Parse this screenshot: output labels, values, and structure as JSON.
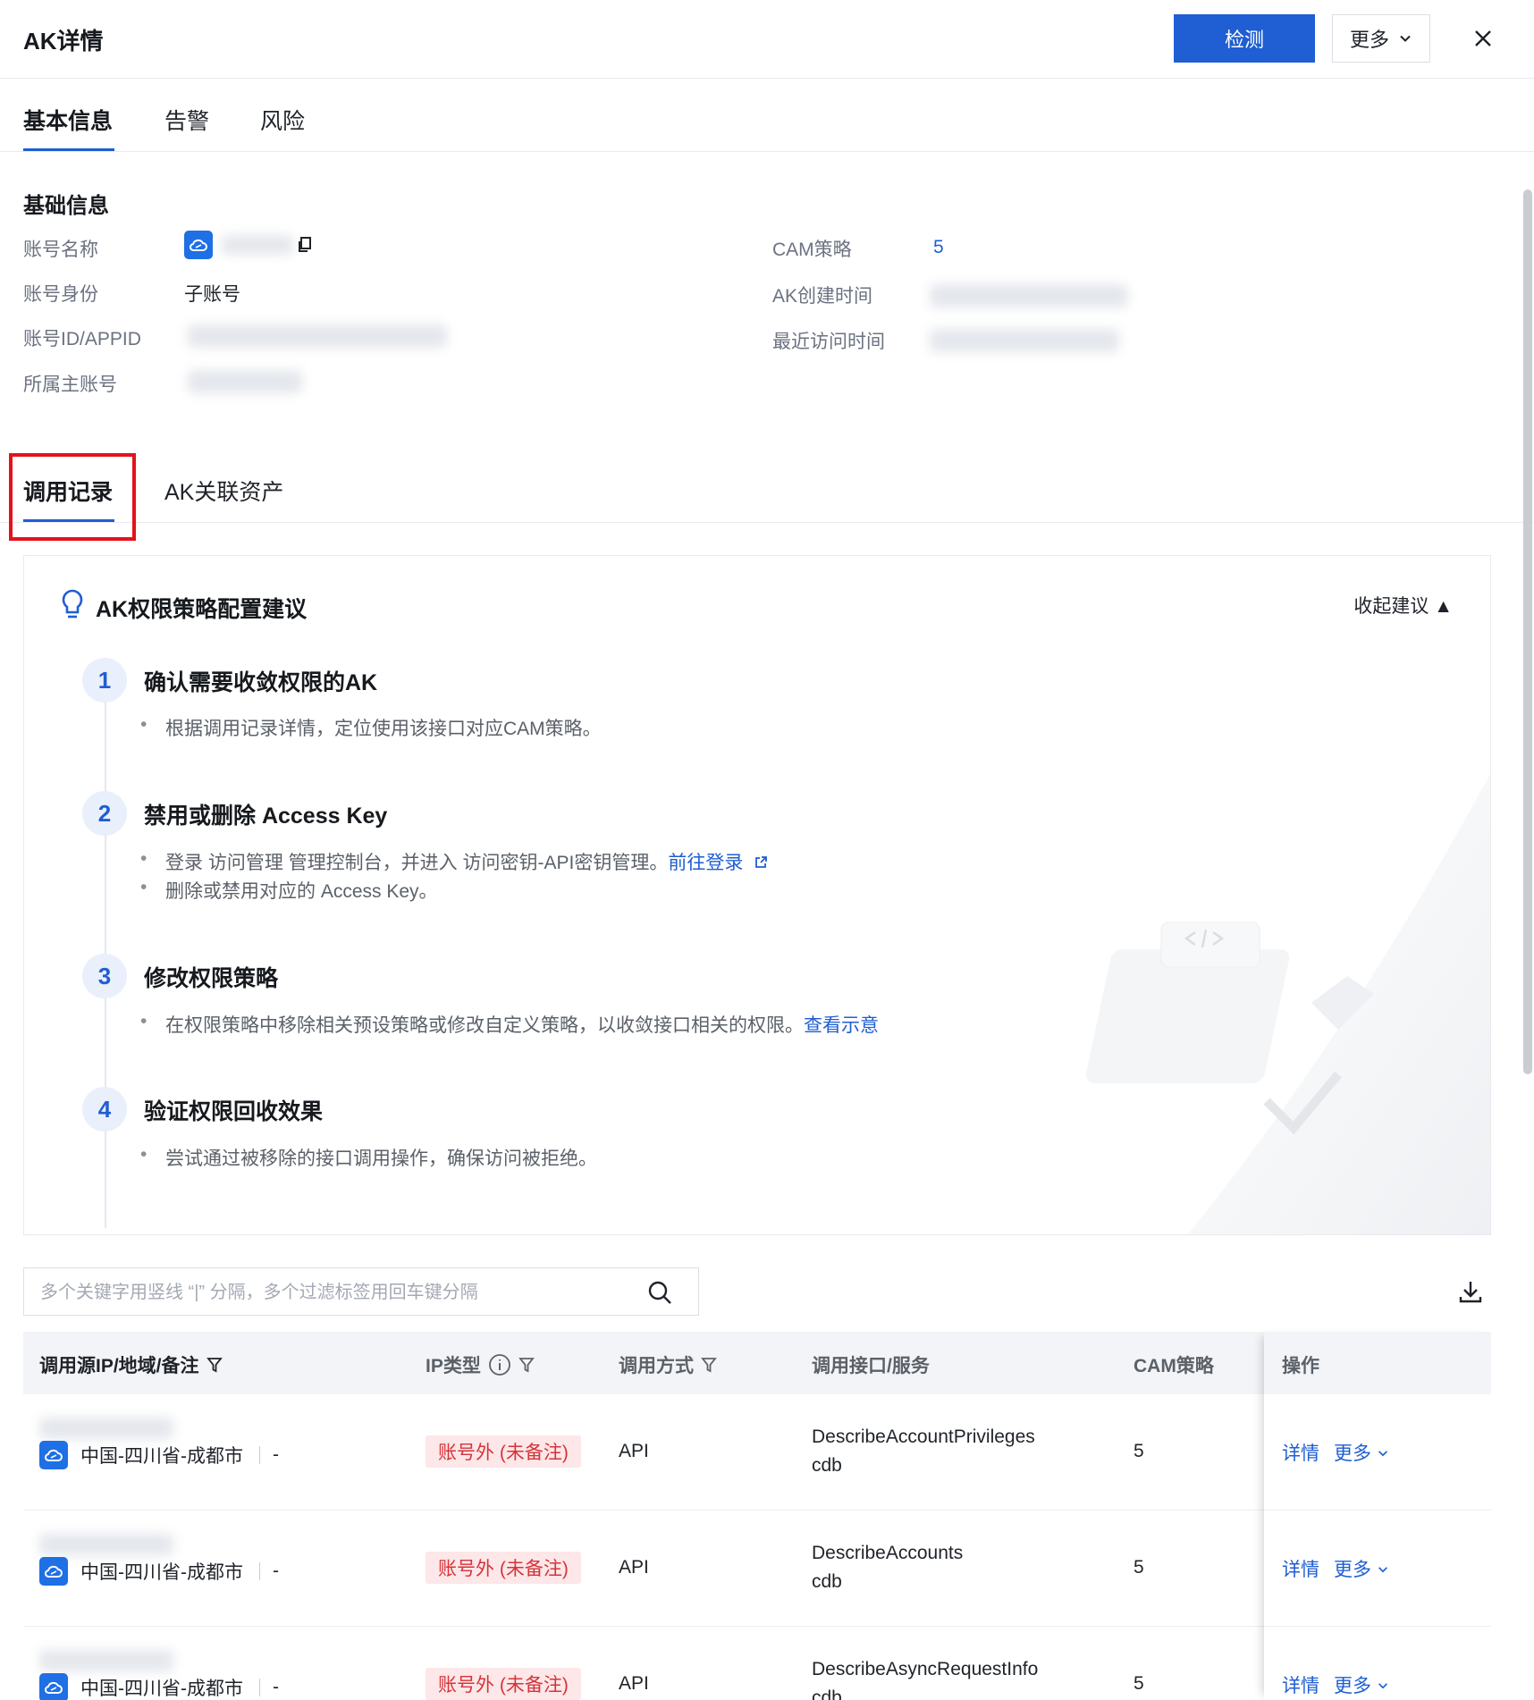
{
  "header": {
    "title": "AK详情",
    "detect_label": "检测",
    "more_label": "更多"
  },
  "main_tabs": [
    "基本信息",
    "告警",
    "风险"
  ],
  "basic_info": {
    "section_title": "基础信息",
    "left": [
      {
        "label": "账号名称"
      },
      {
        "label": "账号身份",
        "value": "子账号"
      },
      {
        "label": "账号ID/APPID"
      },
      {
        "label": "所属主账号"
      }
    ],
    "right": [
      {
        "label": "CAM策略",
        "value": "5"
      },
      {
        "label": "AK创建时间"
      },
      {
        "label": "最近访问时间"
      }
    ]
  },
  "sub_tabs": [
    "调用记录",
    "AK关联资产"
  ],
  "suggestion": {
    "title": "AK权限策略配置建议",
    "collapse_label": "收起建议",
    "steps": [
      {
        "num": "1",
        "title": "确认需要收敛权限的AK",
        "items": [
          {
            "text": "根据调用记录详情，定位使用该接口对应CAM策略。"
          }
        ]
      },
      {
        "num": "2",
        "title": "禁用或删除 Access Key",
        "items": [
          {
            "text": "登录 访问管理 管理控制台，并进入 访问密钥-API密钥管理。",
            "link": "前往登录"
          },
          {
            "text": "删除或禁用对应的 Access Key。"
          }
        ]
      },
      {
        "num": "3",
        "title": "修改权限策略",
        "items": [
          {
            "text": "在权限策略中移除相关预设策略或修改自定义策略，以收敛接口相关的权限。",
            "link": "查看示意"
          }
        ]
      },
      {
        "num": "4",
        "title": "验证权限回收效果",
        "items": [
          {
            "text": "尝试通过被移除的接口调用操作，确保访问被拒绝。"
          }
        ]
      }
    ]
  },
  "search": {
    "placeholder": "多个关键字用竖线 “|” 分隔，多个过滤标签用回车键分隔"
  },
  "table": {
    "columns": [
      "调用源IP/地域/备注",
      "IP类型",
      "调用方式",
      "调用接口/服务",
      "CAM策略",
      "操作"
    ],
    "rows": [
      {
        "region": "中国-四川省-成都市",
        "remark": "-",
        "ip_type": "账号外 (未备注)",
        "method": "API",
        "interface": "DescribeAccountPrivileges",
        "service": "cdb",
        "cam": "5",
        "detail": "详情",
        "more": "更多"
      },
      {
        "region": "中国-四川省-成都市",
        "remark": "-",
        "ip_type": "账号外 (未备注)",
        "method": "API",
        "interface": "DescribeAccounts",
        "service": "cdb",
        "cam": "5",
        "detail": "详情",
        "more": "更多"
      },
      {
        "region": "中国-四川省-成都市",
        "remark": "-",
        "ip_type": "账号外 (未备注)",
        "method": "API",
        "interface": "DescribeAsyncRequestInfo",
        "service": "cdb",
        "cam": "5",
        "detail": "详情",
        "more": "更多"
      }
    ]
  },
  "colors": {
    "primary": "#1f5ed3",
    "danger_tag_bg": "#fde7e8",
    "danger_tag_text": "#d5343a",
    "highlight": "#e5121b"
  }
}
